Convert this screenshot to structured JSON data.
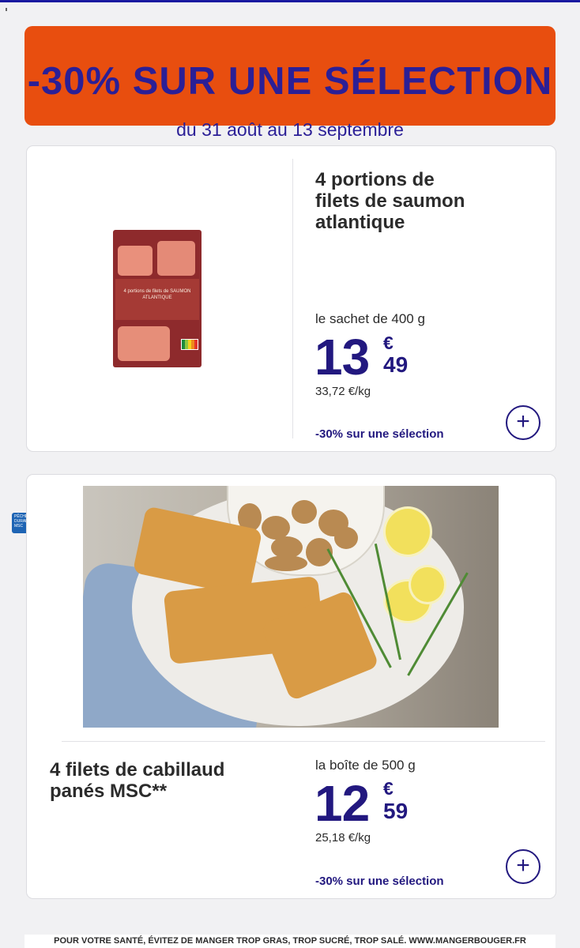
{
  "banner": {
    "title": "-30% SUR UNE SÉLECTION",
    "dates": "du 31 août au 13 septembre",
    "bg_color": "#e84e0f",
    "text_color": "#2b1f96"
  },
  "products": [
    {
      "title_lines": [
        "4 portions de",
        "filets de saumon",
        "atlantique"
      ],
      "image": {
        "package_text": "4 portions de filets de SAUMON ATLANTIQUE"
      },
      "quantity": "le sachet de 400 g",
      "price_int": "13",
      "currency": "€",
      "price_dec": "49",
      "price_per_kg": "33,72 €/kg",
      "promo": "-30% sur une sélection",
      "add_icon": "plus-icon"
    },
    {
      "title_lines": [
        "4 filets de cabillaud",
        "panés MSC**"
      ],
      "badge": {
        "text_lines": [
          "PÊCHE",
          "DURABLE",
          "MSC"
        ],
        "icon": "msc-fish-icon"
      },
      "quantity": "la boîte de 500 g",
      "price_int": "12",
      "currency": "€",
      "price_dec": "59",
      "price_per_kg": "25,18 €/kg",
      "promo": "-30% sur une sélection",
      "add_icon": "plus-icon"
    }
  ],
  "footer": {
    "text": "POUR VOTRE SANTÉ, ÉVITEZ DE MANGER TROP GRAS, TROP SUCRÉ, TROP SALÉ. WWW.MANGERBOUGER.FR"
  },
  "colors": {
    "price": "#22187f",
    "accent": "#e84e0f"
  }
}
